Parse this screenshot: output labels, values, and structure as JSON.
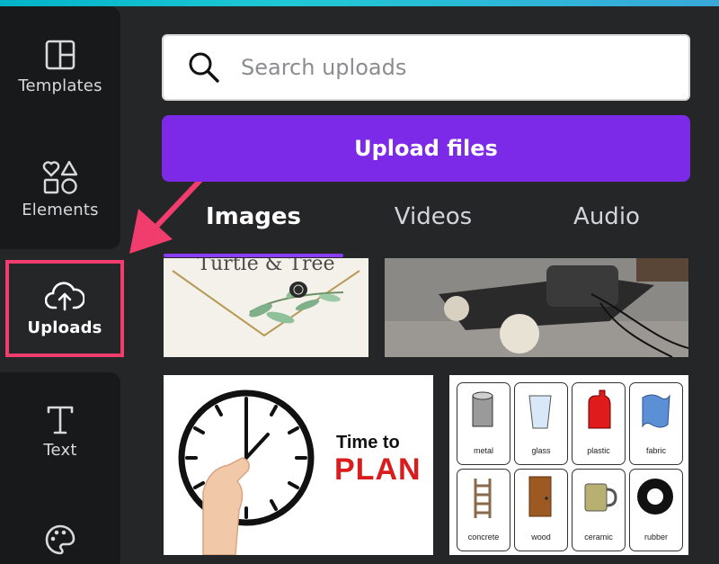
{
  "sidebar": {
    "items": [
      {
        "label": "Templates",
        "icon": "templates-icon"
      },
      {
        "label": "Elements",
        "icon": "elements-icon"
      },
      {
        "label": "Uploads",
        "icon": "cloud-upload-icon"
      },
      {
        "label": "Text",
        "icon": "text-icon"
      },
      {
        "label": "",
        "icon": "palette-icon"
      }
    ]
  },
  "search": {
    "placeholder": "Search uploads",
    "value": ""
  },
  "upload_button": {
    "label": "Upload files"
  },
  "tabs": [
    {
      "label": "Images",
      "active": true
    },
    {
      "label": "Videos",
      "active": false
    },
    {
      "label": "Audio",
      "active": false
    }
  ],
  "thumbnails": {
    "turtle": {
      "text": "Turtle & Tree"
    },
    "clock": {
      "text1": "Time to",
      "text2": "PLAN"
    },
    "materials": [
      "metal",
      "glass",
      "plastic",
      "fabric",
      "concrete",
      "wood",
      "ceramic",
      "rubber"
    ]
  },
  "colors": {
    "accent": "#7d2ae8",
    "highlight_border": "#f13c6e",
    "sidebar_bg": "#18191b",
    "panel_bg": "#252627"
  }
}
